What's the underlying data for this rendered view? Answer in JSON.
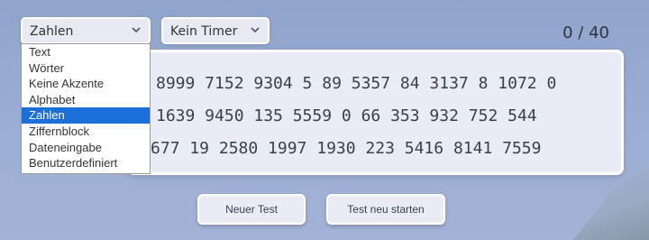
{
  "mode_select": {
    "value": "Zahlen",
    "icon": "chevron-down-icon"
  },
  "timer_select": {
    "value": "Kein Timer",
    "icon": "chevron-down-icon"
  },
  "counter": "0 / 40",
  "dropdown": {
    "options": [
      "Text",
      "Wörter",
      "Keine Akzente",
      "Alphabet",
      "Zahlen",
      "Ziffernblock",
      "Dateneingabe",
      "Benutzerdefiniert"
    ],
    "selected": "Zahlen"
  },
  "test_text": {
    "line1": "8999 7152 9304 5 89 5357 84 3137 8 1072 0",
    "line2": "1639 9450 135 5559 0 66 353 932 752 544",
    "line3": "677 19 2580 1997 1930 223 5416 8141 7559"
  },
  "buttons": {
    "new_test": "Neuer Test",
    "restart": "Test neu starten"
  },
  "colors": {
    "selected_option": "#1a6fd8",
    "panel": "#e9ecf5",
    "background": "#9aacd3"
  }
}
